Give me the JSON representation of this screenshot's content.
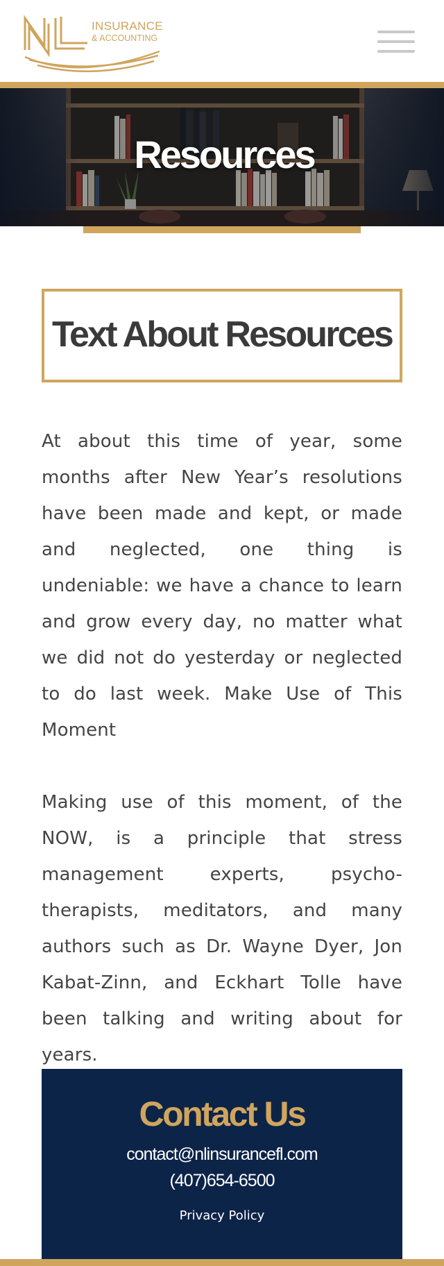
{
  "brand": {
    "line1": "INSURANCE",
    "line2": "& ACCOUNTING",
    "logo_letters": "NL",
    "accent_color": "#cfa55e",
    "navy_color": "#0d2449"
  },
  "header": {
    "menu_icon": "hamburger-menu-icon"
  },
  "hero": {
    "title": "Resources"
  },
  "content": {
    "heading": "Text About Resources",
    "paragraphs": [
      "At about this time of year, some months after New Year’s resolutions have been made and kept, or made and neglected, one thing is undeniable: we have a chance to learn and grow every day, no matter what we did not do yesterday or neglected to do last week.  Make Use of This Moment",
      "Making use of this moment, of the NOW, is a principle that stress management experts, psycho-therapists, meditators, and many authors such as Dr. Wayne Dyer, Jon Kabat-Zinn, and Eckhart Tolle have been talking and writing about for years."
    ]
  },
  "contact": {
    "title": "Contact Us",
    "email": "contact@nlinsurancefl.com",
    "phone": "(407)654-6500",
    "privacy_label": "Privacy Policy"
  }
}
